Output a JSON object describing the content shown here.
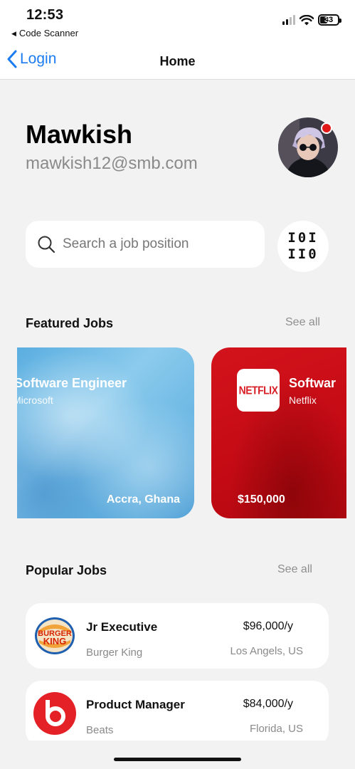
{
  "status_bar": {
    "time": "12:53",
    "back_app": "Code Scanner",
    "battery": "33"
  },
  "nav": {
    "back_label": "Login",
    "title": "Home"
  },
  "profile": {
    "name": "Mawkish",
    "email": "mawkish12@smb.com"
  },
  "search": {
    "placeholder": "Search a job position",
    "value": "",
    "scan_glyph_top": "I0I",
    "scan_glyph_bottom": "II0"
  },
  "featured": {
    "title": "Featured Jobs",
    "see_all": "See all",
    "cards": [
      {
        "title": "Software Engineer",
        "company": "Microsoft",
        "location": "Accra, Ghana",
        "salary": ""
      },
      {
        "title": "Softwar",
        "company": "Netflix",
        "salary": "$150,000",
        "logo_text": "NETFLIX"
      }
    ]
  },
  "popular": {
    "title": "Popular Jobs",
    "see_all": "See all",
    "jobs": [
      {
        "title": "Jr Executive",
        "company": "Burger King",
        "salary": "$96,000/y",
        "location": "Los Angels, US",
        "logo_top": "BURGER",
        "logo_bottom": "KING"
      },
      {
        "title": "Product Manager",
        "company": "Beats",
        "salary": "$84,000/y",
        "location": "Florida, US",
        "logo_letter": "b"
      }
    ]
  },
  "colors": {
    "accent_blue": "#1a7cf0",
    "netflix_red": "#c40a14",
    "notification_red": "#e01818",
    "beats_red": "#e42127"
  }
}
